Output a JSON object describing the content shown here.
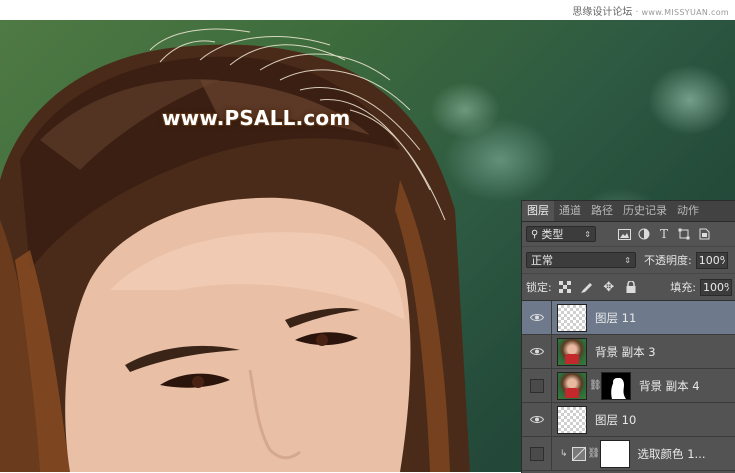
{
  "site": {
    "brand_cn": "思缘设计论坛",
    "domain": "www.MISSYUAN.com"
  },
  "watermark": "www.PSALL.com",
  "panel": {
    "tabs": [
      "图层",
      "通道",
      "路径",
      "历史记录",
      "动作"
    ],
    "active_tab": "图层",
    "filter": {
      "label": "类型",
      "icons": [
        "image-filter-icon",
        "adjustment-filter-icon",
        "type-filter-icon",
        "shape-filter-icon",
        "smart-object-filter-icon"
      ]
    },
    "blend_mode": "正常",
    "opacity_label": "不透明度:",
    "opacity_value": "100%",
    "lock_label": "锁定:",
    "fill_label": "填充:",
    "fill_value": "100%",
    "layers": [
      {
        "name": "图层 11",
        "visible": true,
        "selected": true,
        "thumb": "transparent"
      },
      {
        "name": "背景 副本 3",
        "visible": true,
        "selected": false,
        "thumb": "photo"
      },
      {
        "name": "背景 副本 4",
        "visible": false,
        "selected": false,
        "thumb": "photo",
        "mask": true
      },
      {
        "name": "图层 10",
        "visible": true,
        "selected": false,
        "thumb": "transparent"
      },
      {
        "name": "选取颜色 1...",
        "visible": false,
        "selected": false,
        "thumb": "adjustment",
        "mask": true
      }
    ]
  },
  "colors": {
    "panel_bg": "#535353",
    "tab_bar": "#424242",
    "selected_row": "#6e7a8c",
    "watermark_outline": "#5a3418"
  }
}
